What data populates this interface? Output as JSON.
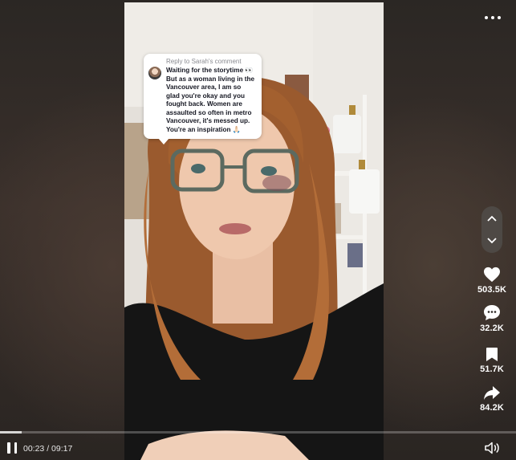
{
  "reply": {
    "header": "Reply to Sarah's comment",
    "text": "Waiting for the storytime 👀 But as a woman living in the Vancouver area, I am so glad you're okay and you fought back. Women are assaulted so often in metro Vancouver, it's messed up. You're an inspiration 🙏🏻"
  },
  "actions": {
    "likes": "503.5K",
    "comments": "32.2K",
    "saves": "51.7K",
    "shares": "84.2K"
  },
  "player": {
    "time": "00:23 / 09:17",
    "progress": 0.0413
  },
  "icons": {
    "more": "more-dots-icon",
    "up": "chevron-up-icon",
    "down": "chevron-down-icon",
    "like": "heart-icon",
    "comment": "comment-bubble-icon",
    "save": "bookmark-icon",
    "share": "share-arrow-icon",
    "pause": "pause-icon",
    "volume": "volume-icon"
  }
}
